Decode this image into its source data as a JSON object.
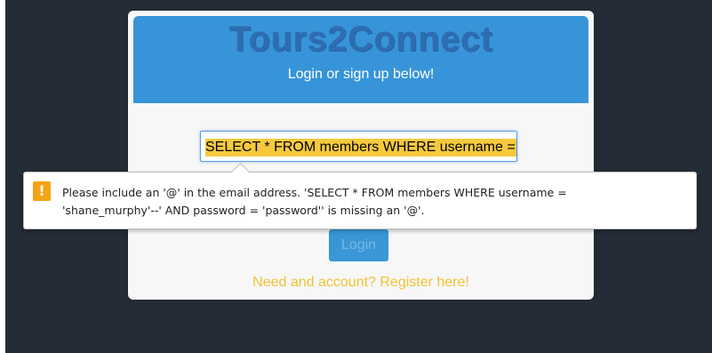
{
  "app": {
    "brand": "Tours2Connect",
    "tagline": "Login or sign up below!"
  },
  "form": {
    "email_value": "SELECT * FROM members WHERE username = 'shane_murphy'--' AND password = 'password'",
    "login_label": "Login",
    "register_link": "Need and account? Register here!"
  },
  "validation": {
    "icon": "warning-icon",
    "message_line1": "Please include an '@' in the email address. 'SELECT * FROM members WHERE username =",
    "message_line2": "'shane_murphy'--' AND password = 'password'' is missing an '@'."
  },
  "colors": {
    "banner": "#3794d9",
    "brand_text": "#2e6db1",
    "highlight": "#f6c93d",
    "register_link": "#f2c233",
    "warning": "#f6a313",
    "background": "#232b37"
  }
}
